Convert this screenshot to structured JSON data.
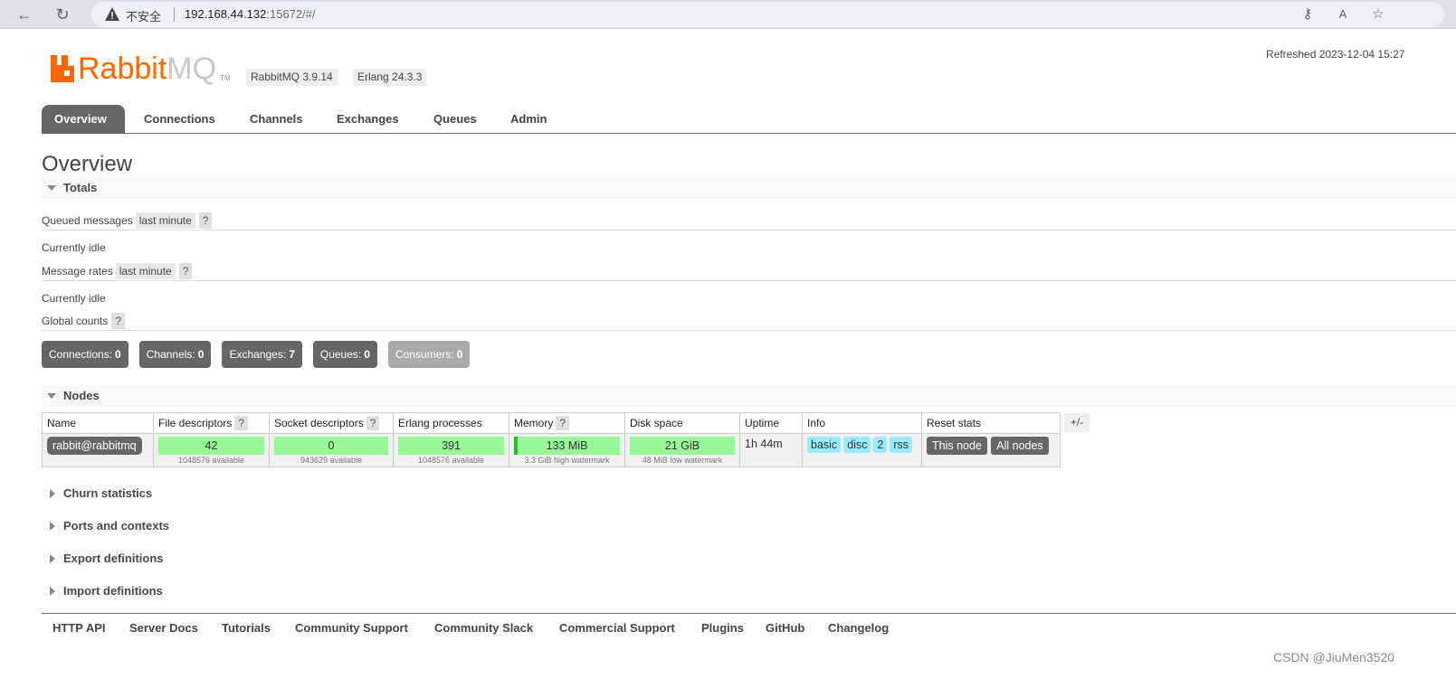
{
  "browser": {
    "insecure_label": "不安全",
    "url_host": "192.168.44.132",
    "url_rest": ":15672/#/"
  },
  "header": {
    "logo_rabbit": "Rabbit",
    "logo_mq": "MQ",
    "logo_tm": "TM",
    "rabbitmq_version": "RabbitMQ 3.9.14",
    "erlang_version": "Erlang 24.3.3",
    "refreshed": "Refreshed 2023-12-04 15:27"
  },
  "tabs": [
    {
      "label": "Overview",
      "active": true
    },
    {
      "label": "Connections"
    },
    {
      "label": "Channels"
    },
    {
      "label": "Exchanges"
    },
    {
      "label": "Queues"
    },
    {
      "label": "Admin"
    }
  ],
  "page_title": "Overview",
  "totals": {
    "title": "Totals",
    "queued_messages_label": "Queued messages",
    "queued_messages_range": "last minute",
    "queued_idle": "Currently idle",
    "message_rates_label": "Message rates",
    "message_rates_range": "last minute",
    "rates_idle": "Currently idle",
    "global_counts_label": "Global counts",
    "help": "?",
    "counts": [
      {
        "label": "Connections:",
        "value": "0"
      },
      {
        "label": "Channels:",
        "value": "0"
      },
      {
        "label": "Exchanges:",
        "value": "7"
      },
      {
        "label": "Queues:",
        "value": "0"
      },
      {
        "label": "Consumers:",
        "value": "0"
      }
    ]
  },
  "nodes": {
    "title": "Nodes",
    "columns": [
      "Name",
      "File descriptors",
      "Socket descriptors",
      "Erlang processes",
      "Memory",
      "Disk space",
      "Uptime",
      "Info",
      "Reset stats"
    ],
    "plus_minus": "+/-",
    "row": {
      "name": "rabbit@rabbitmq",
      "file_descriptors": "42",
      "file_descriptors_sub": "1048576 available",
      "socket_descriptors": "0",
      "socket_descriptors_sub": "943629 available",
      "erlang_processes": "391",
      "erlang_processes_sub": "1048576 available",
      "memory": "133 MiB",
      "memory_sub": "3.3 GiB high watermark",
      "disk_space": "21 GiB",
      "disk_space_sub": "48 MiB low watermark",
      "uptime": "1h 44m",
      "info_tags": [
        "basic",
        "disc",
        "2",
        "rss"
      ],
      "reset_this_node": "This node",
      "reset_all_nodes": "All nodes"
    }
  },
  "collapsed_sections": [
    "Churn statistics",
    "Ports and contexts",
    "Export definitions",
    "Import definitions"
  ],
  "footer_links": [
    "HTTP API",
    "Server Docs",
    "Tutorials",
    "Community Support",
    "Community Slack",
    "Commercial Support",
    "Plugins",
    "GitHub",
    "Changelog"
  ],
  "watermark": "CSDN @JiuMen3520",
  "colors": {
    "brand_orange": "#ff6600",
    "tab_active": "#666666",
    "bar_green": "#98f898",
    "info_tag": "#99ebff"
  }
}
